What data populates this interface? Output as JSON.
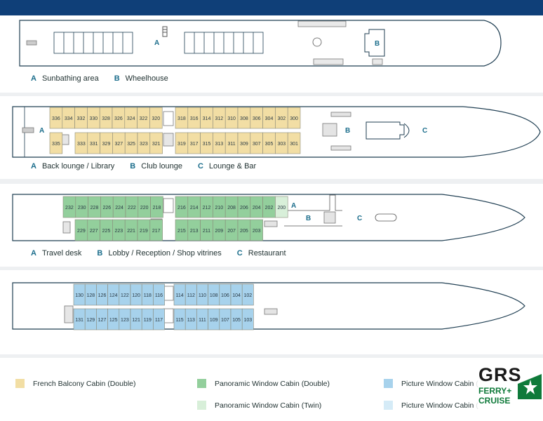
{
  "colors": {
    "header": "#0f3f78",
    "french_balcony_double": "#f2dea4",
    "panoramic_double": "#93cf9c",
    "panoramic_twin": "#d8efd9",
    "picture_window_dark": "#a7d2ec",
    "picture_window_light": "#d5ebf7",
    "hull_stroke": "#1f3e52",
    "label_accent": "#1c6e8c"
  },
  "decks": [
    {
      "key": "sun",
      "area_labels": [
        {
          "text": "A"
        },
        {
          "text": "B"
        }
      ],
      "legend": [
        {
          "letter": "A",
          "text": "Sunbathing area"
        },
        {
          "letter": "B",
          "text": "Wheelhouse"
        }
      ],
      "cabin_rows": []
    },
    {
      "key": "deck3",
      "area_labels": [
        {
          "text": "A"
        },
        {
          "text": "B"
        },
        {
          "text": "C"
        }
      ],
      "legend": [
        {
          "letter": "A",
          "text": "Back lounge / Library"
        },
        {
          "letter": "B",
          "text": "Club lounge"
        },
        {
          "letter": "C",
          "text": "Lounge & Bar"
        }
      ],
      "cabin_rows": [
        {
          "style": "french_balcony_double",
          "groups": [
            [
              "336",
              "334",
              "332",
              "330",
              "328",
              "326",
              "324",
              "322",
              "320"
            ],
            [
              "318",
              "316",
              "314",
              "312",
              "310",
              "308",
              "306",
              "304",
              "302",
              "300"
            ]
          ]
        },
        {
          "style": "french_balcony_double",
          "groups": [
            [
              "335"
            ],
            [
              "333",
              "331",
              "329",
              "327",
              "325",
              "323",
              "321"
            ],
            [
              "319",
              "317",
              "315",
              "313",
              "311",
              "309",
              "307",
              "305",
              "303",
              "301"
            ]
          ]
        }
      ]
    },
    {
      "key": "deck2",
      "area_labels": [
        {
          "text": "A"
        },
        {
          "text": "B"
        },
        {
          "text": "C"
        }
      ],
      "legend": [
        {
          "letter": "A",
          "text": "Travel desk"
        },
        {
          "letter": "B",
          "text": "Lobby / Reception / Shop vitrines"
        },
        {
          "letter": "C",
          "text": "Restaurant"
        }
      ],
      "cabin_rows": [
        {
          "style": "panoramic_double",
          "groups": [
            [
              "232",
              "230",
              "228",
              "226",
              "224",
              "222",
              "220",
              "218"
            ],
            [
              "216",
              "214",
              "212",
              "210",
              "208",
              "206",
              "204",
              "202",
              "200"
            ]
          ]
        },
        {
          "style": "panoramic_double",
          "groups": [
            [
              "229",
              "227",
              "225",
              "223",
              "221",
              "219",
              "217"
            ],
            [
              "215",
              "213",
              "211",
              "209",
              "207",
              "205",
              "203"
            ]
          ]
        }
      ]
    },
    {
      "key": "deck1",
      "area_labels": [],
      "legend": [],
      "cabin_rows": [
        {
          "style": "picture_window_dark",
          "groups": [
            [
              "130",
              "128",
              "126",
              "124",
              "122",
              "120",
              "118",
              "116"
            ],
            [
              "114",
              "112",
              "110",
              "108",
              "106",
              "104",
              "102"
            ]
          ]
        },
        {
          "style": "picture_window_dark",
          "groups": [
            [
              "131",
              "129",
              "127",
              "125",
              "123",
              "121",
              "119",
              "117"
            ],
            [
              "115",
              "113",
              "111",
              "109",
              "107",
              "105",
              "103"
            ]
          ]
        }
      ]
    }
  ],
  "cabin_legend": [
    {
      "label": "French Balcony Cabin (Double)",
      "color": "#f2dea4"
    },
    {
      "label": "Panoramic Window Cabin (Double)",
      "color": "#93cf9c"
    },
    {
      "label": "Panoramic Window Cabin (Twin)",
      "color": "#d8efd9"
    },
    {
      "label": "Picture Window Cabin (",
      "color": "#a7d2ec"
    },
    {
      "label": "Picture Window Cabin (",
      "color": "#d5ebf7"
    }
  ],
  "logo": {
    "line1": "GRS",
    "line2": "FERRY+",
    "line3": "CRUISE"
  }
}
